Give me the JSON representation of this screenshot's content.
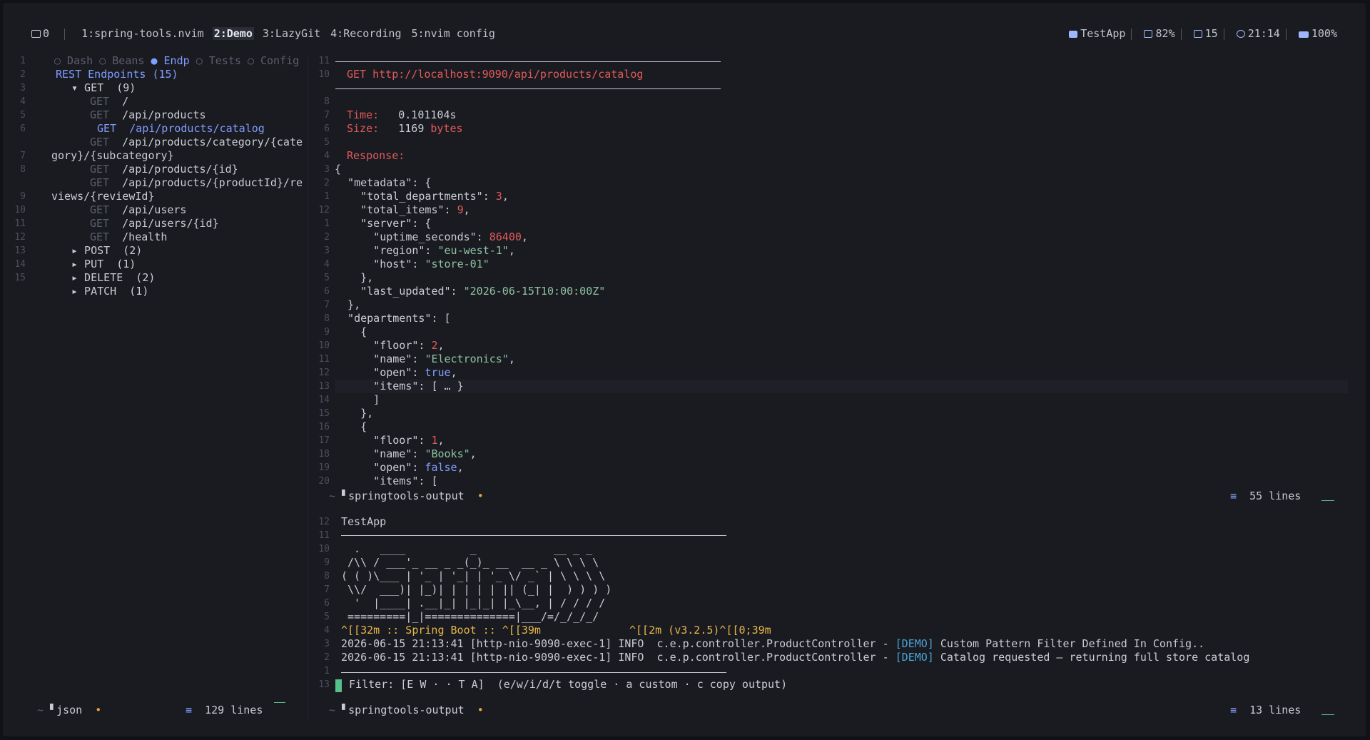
{
  "tabbar": {
    "session_icon": "terminal-icon",
    "session_num": "0",
    "tabs": [
      "1:spring-tools.nvim",
      "2:Demo",
      "3:LazyGit",
      "4:Recording",
      "5:nvim config"
    ],
    "active_tab": 1
  },
  "status": {
    "project": "TestApp",
    "memory": "82%",
    "date": "15",
    "time": "21:14",
    "battery": "100%"
  },
  "sidebar": {
    "nav": [
      "○ Dash",
      "○ Beans",
      "● Endp",
      "○ Tests",
      "○ Config"
    ],
    "title": "REST Endpoints (15)",
    "get_group": "▾ GET  (9)",
    "get_items": [
      {
        "method": "GET",
        "path": "/"
      },
      {
        "method": "GET",
        "path": "/api/products"
      },
      {
        "method": "GET",
        "path": "/api/products/catalog"
      },
      {
        "method": "GET",
        "path": "/api/products/category/{cate"
      },
      {
        "method": "",
        "path": "gory}/{subcategory}"
      },
      {
        "method": "GET",
        "path": "/api/products/{id}"
      },
      {
        "method": "GET",
        "path": "/api/products/{productId}/re"
      },
      {
        "method": "",
        "path": "views/{reviewId}"
      },
      {
        "method": "GET",
        "path": "/api/users"
      },
      {
        "method": "GET",
        "path": "/api/users/{id}"
      },
      {
        "method": "GET",
        "path": "/health"
      }
    ],
    "groups": [
      "▸ POST  (2)",
      "▸ PUT  (1)",
      "▸ DELETE  (2)",
      "▸ PATCH  (1)"
    ],
    "line_numbers": [
      "1",
      "2",
      "3",
      "4",
      "5",
      "6",
      "",
      "7",
      "8",
      "",
      "9",
      "10",
      "11",
      "12",
      "13",
      "14",
      "15"
    ],
    "statusline_name": "json",
    "statusline_lines": "129 lines"
  },
  "response": {
    "request_method": "GET",
    "request_url": "http://localhost:9090/api/products/catalog",
    "time_label": "Time:",
    "time_value": "0.101104s",
    "size_label": "Size:",
    "size_value": "1169",
    "size_unit": "bytes",
    "response_label": "Response:",
    "statusline_name": "springtools-output",
    "statusline_lines": "55 lines"
  },
  "output": {
    "title": "TestApp",
    "ascii": [
      "  .   ____          _            __ _ _",
      " /\\\\ / ___'_ __ _ _(_)_ __  __ _ \\ \\ \\ \\",
      "( ( )\\___ | '_ | '_| | '_ \\/ _` | \\ \\ \\ \\",
      " \\\\/  ___)| |_)| | | | | || (_| |  ) ) ) )",
      "  '  |____| .__|_| |_|_| |_\\__, | / / / /",
      " =========|_|==============|___/=/_/_/_/"
    ],
    "boot_line_a": "^[[32m :: Spring Boot :: ^[[39m",
    "boot_line_b": "^[[2m (v3.2.5)^[[0;39m",
    "logs": [
      {
        "prefix": "2026-06-15 21:13:41 [http-nio-9090-exec-1] INFO  c.e.p.controller.ProductController - ",
        "tag": "[DEMO]",
        "msg": " Custom Pattern Filter Defined In Config.."
      },
      {
        "prefix": "2026-06-15 21:13:41 [http-nio-9090-exec-1] INFO  c.e.p.controller.ProductController - ",
        "tag": "[DEMO]",
        "msg": " Catalog requested — returning full store catalog"
      }
    ],
    "filter_line": " Filter: [E W · · T A]  (e/w/i/d/t toggle · a custom · c copy output)",
    "statusline_name": "springtools-output",
    "statusline_lines": "13 lines"
  },
  "json_lines": [
    {
      "n": "3",
      "t": [
        [
          "k",
          "{"
        ]
      ]
    },
    {
      "n": "2",
      "t": [
        [
          "k",
          "  \"metadata\": {"
        ]
      ]
    },
    {
      "n": "1",
      "t": [
        [
          "k",
          "    \"total_departments\": "
        ],
        [
          "num",
          "3"
        ],
        [
          "k",
          ","
        ]
      ]
    },
    {
      "n": "12",
      "t": [
        [
          "k",
          "    \"total_items\": "
        ],
        [
          "num",
          "9"
        ],
        [
          "k",
          ","
        ]
      ]
    },
    {
      "n": "1",
      "t": [
        [
          "k",
          "    \"server\": {"
        ]
      ]
    },
    {
      "n": "2",
      "t": [
        [
          "k",
          "      \"uptime_seconds\": "
        ],
        [
          "num",
          "86400"
        ],
        [
          "k",
          ","
        ]
      ]
    },
    {
      "n": "3",
      "t": [
        [
          "k",
          "      \"region\": "
        ],
        [
          "str",
          "\"eu-west-1\""
        ],
        [
          "k",
          ","
        ]
      ]
    },
    {
      "n": "4",
      "t": [
        [
          "k",
          "      \"host\": "
        ],
        [
          "str",
          "\"store-01\""
        ]
      ]
    },
    {
      "n": "5",
      "t": [
        [
          "k",
          "    },"
        ]
      ]
    },
    {
      "n": "6",
      "t": [
        [
          "k",
          "    \"last_updated\": "
        ],
        [
          "str",
          "\"2026-06-15T10:00:00Z\""
        ]
      ]
    },
    {
      "n": "7",
      "t": [
        [
          "k",
          "  },"
        ]
      ]
    },
    {
      "n": "8",
      "t": [
        [
          "k",
          "  \"departments\": ["
        ]
      ]
    },
    {
      "n": "9",
      "t": [
        [
          "k",
          "    {"
        ]
      ]
    },
    {
      "n": "10",
      "t": [
        [
          "k",
          "      \"floor\": "
        ],
        [
          "num",
          "2"
        ],
        [
          "k",
          ","
        ]
      ]
    },
    {
      "n": "11",
      "t": [
        [
          "k",
          "      \"name\": "
        ],
        [
          "str",
          "\"Electronics\""
        ],
        [
          "k",
          ","
        ]
      ]
    },
    {
      "n": "12",
      "t": [
        [
          "k",
          "      \"open\": "
        ],
        [
          "boo",
          "true"
        ],
        [
          "k",
          ","
        ]
      ]
    },
    {
      "n": "13",
      "t": [
        [
          "k",
          "      \"items\": [ … }"
        ]
      ]
    },
    {
      "n": "14",
      "t": [
        [
          "k",
          "      ]"
        ]
      ]
    },
    {
      "n": "15",
      "t": [
        [
          "k",
          "    },"
        ]
      ]
    },
    {
      "n": "16",
      "t": [
        [
          "k",
          "    {"
        ]
      ]
    },
    {
      "n": "17",
      "t": [
        [
          "k",
          "      \"floor\": "
        ],
        [
          "num",
          "1"
        ],
        [
          "k",
          ","
        ]
      ]
    },
    {
      "n": "18",
      "t": [
        [
          "k",
          "      \"name\": "
        ],
        [
          "str",
          "\"Books\""
        ],
        [
          "k",
          ","
        ]
      ]
    },
    {
      "n": "19",
      "t": [
        [
          "k",
          "      \"open\": "
        ],
        [
          "boo",
          "false"
        ],
        [
          "k",
          ","
        ]
      ]
    },
    {
      "n": "20",
      "t": [
        [
          "k",
          "      \"items\": ["
        ]
      ]
    }
  ]
}
